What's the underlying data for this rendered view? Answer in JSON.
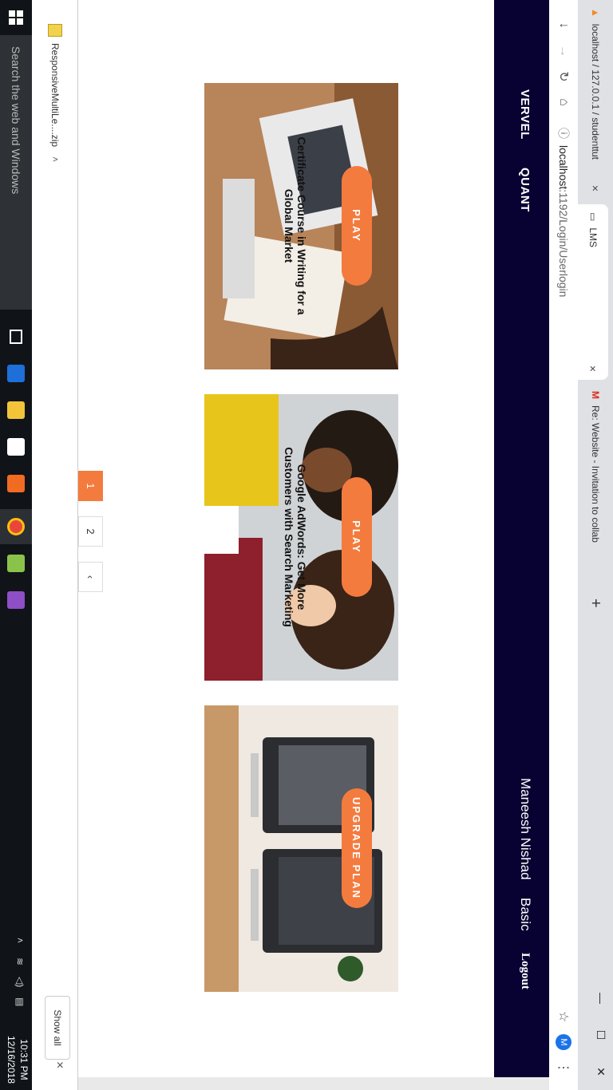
{
  "browser": {
    "tabs": [
      {
        "label": "localhost / 127.0.0.1 / studenttut"
      },
      {
        "label": "LMS"
      },
      {
        "label": "Re: Website - Invitation to collab"
      }
    ],
    "new_tab": "+",
    "url_host": "localhost",
    "url_path": ":1192/Login/Userlogin",
    "profile_initial": "M",
    "menu": "⋮"
  },
  "site": {
    "nav": [
      {
        "label": "VERVEL"
      },
      {
        "label": "QUANT"
      }
    ],
    "user_name": "Maneesh Nishad",
    "plan": "Basic",
    "logout": "Logout"
  },
  "courses": [
    {
      "title": "Certificate Course in Writing for a Global Market",
      "button": "PLAY"
    },
    {
      "title": "Google AdWords: Get More Customers with Search Marketing",
      "button": "PLAY"
    },
    {
      "title": "",
      "button": "UPGRADE PLAN"
    }
  ],
  "pagination": {
    "pages": [
      "1",
      "2"
    ],
    "current": "1",
    "prev": "‹"
  },
  "downloads": {
    "file": "ResponsiveMultiLe....zip",
    "show_all": "Show all",
    "close": "×"
  },
  "taskbar": {
    "search_placeholder": "Search the web and Windows",
    "time": "10:31 PM",
    "date": "12/16/2018"
  },
  "colors": {
    "accent": "#f47b3e",
    "sidebar": "#080232"
  }
}
